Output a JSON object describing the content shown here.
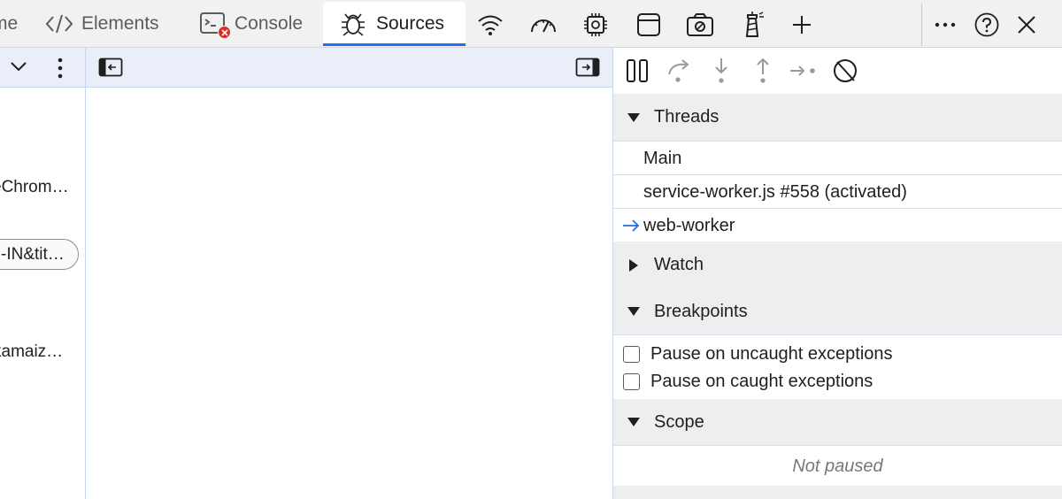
{
  "tabs": [
    {
      "label": "me",
      "icon": "none"
    },
    {
      "label": "Elements",
      "icon": "code-icon"
    },
    {
      "label": "Console",
      "icon": "console-icon"
    },
    {
      "label": "Sources",
      "icon": "bug-icon",
      "active": true
    }
  ],
  "toolbar_icons": [
    "wifi-icon",
    "performance-gauge-icon",
    "memory-chip-icon",
    "application-window-icon",
    "recorder-icon",
    "lighthouse-icon",
    "add-icon"
  ],
  "window_actions": [
    "more-icon",
    "help-icon",
    "close-icon"
  ],
  "navigator": {
    "items": [
      "eChrom…",
      "-IN&tit…",
      "kamaiz…"
    ]
  },
  "debugger": {
    "toolbar": [
      "pause-icon",
      "step-over-icon",
      "step-into-icon",
      "step-out-icon",
      "step-icon",
      "deactivate-breakpoints-icon"
    ],
    "threads": {
      "title": "Threads",
      "items": [
        {
          "label": "Main",
          "current": false
        },
        {
          "label": "service-worker.js #558 (activated)",
          "current": false
        },
        {
          "label": "web-worker",
          "current": true
        }
      ]
    },
    "watch": {
      "title": "Watch"
    },
    "breakpoints": {
      "title": "Breakpoints",
      "options": [
        "Pause on uncaught exceptions",
        "Pause on caught exceptions"
      ]
    },
    "scope": {
      "title": "Scope",
      "status": "Not paused"
    }
  },
  "colors": {
    "accent": "#1a73e8",
    "error_badge": "#d93025",
    "panel_header": "#e9eef8",
    "section_header": "#eeeeee"
  }
}
